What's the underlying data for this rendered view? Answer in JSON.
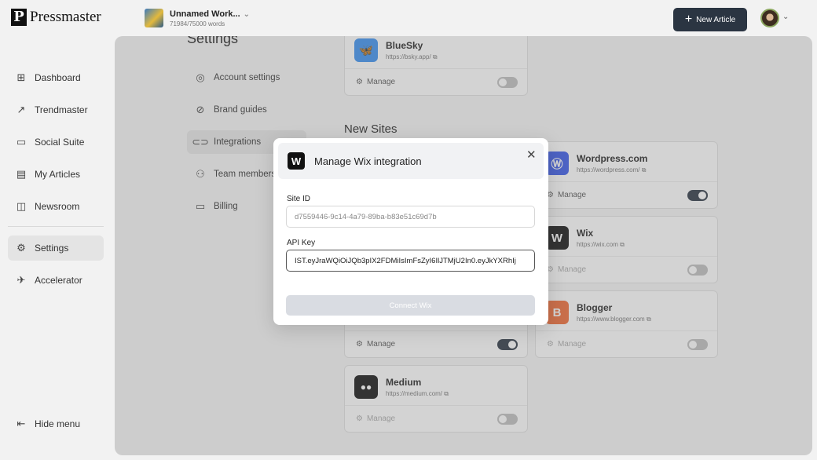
{
  "app": {
    "logo_mark": "P",
    "logo_text": "Pressmaster"
  },
  "workspace": {
    "name": "Unnamed Work...",
    "words": "71984/75000 words",
    "caret": "⌄"
  },
  "header": {
    "new_article_plus": "+",
    "new_article_label": "New Article",
    "avatar_caret": "⌄"
  },
  "sidebar": {
    "items": [
      {
        "label": "Dashboard",
        "icon": "grid-icon",
        "glyph": "⊞"
      },
      {
        "label": "Trendmaster",
        "icon": "trend-icon",
        "glyph": "↗"
      },
      {
        "label": "Social Suite",
        "icon": "social-icon",
        "glyph": "▭"
      },
      {
        "label": "My Articles",
        "icon": "articles-icon",
        "glyph": "▤"
      },
      {
        "label": "Newsroom",
        "icon": "newsroom-icon",
        "glyph": "◫"
      },
      {
        "label": "Settings",
        "icon": "gear-icon",
        "glyph": "⚙"
      },
      {
        "label": "Accelerator",
        "icon": "rocket-icon",
        "glyph": "✈"
      }
    ],
    "hide_menu": {
      "label": "Hide menu",
      "glyph": "⇤"
    }
  },
  "settings": {
    "title": "Settings",
    "nav": [
      {
        "label": "Account settings",
        "glyph": "◎"
      },
      {
        "label": "Brand guides",
        "glyph": "⊘"
      },
      {
        "label": "Integrations",
        "glyph": "⊂⊃"
      },
      {
        "label": "Team members",
        "glyph": "⚇"
      },
      {
        "label": "Billing",
        "glyph": "▭"
      }
    ],
    "new_sites_title": "New Sites"
  },
  "cards": {
    "bluesky": {
      "name": "BlueSky",
      "url": "https://bsky.app/",
      "manage": "Manage",
      "color": "#3a8ff0"
    },
    "wordpress": {
      "name": "Wordpress.com",
      "url": "https://wordpress.com/",
      "manage": "Manage",
      "color": "#3858e9"
    },
    "wix": {
      "name": "Wix",
      "url": "https://wix.com",
      "manage": "Manage",
      "color": "#111111"
    },
    "blogger": {
      "name": "Blogger",
      "url": "https://www.blogger.com",
      "manage": "Manage",
      "color": "#f06a35"
    },
    "hidden_site": {
      "manage": "Manage"
    },
    "medium": {
      "name": "Medium",
      "url": "https://medium.com/",
      "manage": "Manage",
      "color": "#111111"
    }
  },
  "modal": {
    "logo_mark": "W",
    "title": "Manage Wix integration",
    "close": "✕",
    "site_id_label": "Site ID",
    "site_id_value": "d7559446-9c14-4a79-89ba-b83e51c69d7b",
    "api_key_label": "API Key",
    "api_key_value": "IST.eyJraWQiOiJQb3pIX2FDMiIsImFsZyI6IlJTMjU2In0.eyJkYXRhIj",
    "connect_label": "Connect Wix"
  }
}
